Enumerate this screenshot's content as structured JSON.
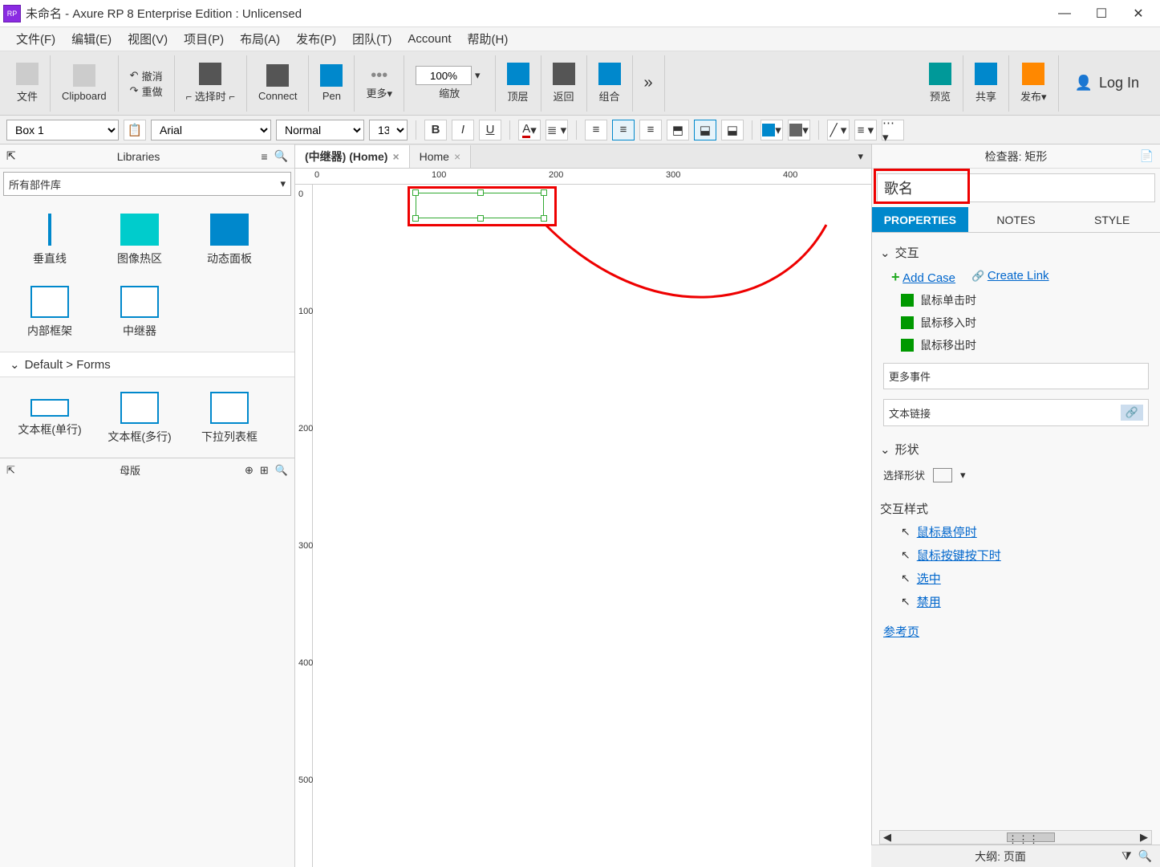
{
  "titlebar": {
    "logo": "RP",
    "title": "未命名 - Axure RP 8 Enterprise Edition : Unlicensed"
  },
  "menubar": [
    "文件(F)",
    "编辑(E)",
    "视图(V)",
    "项目(P)",
    "布局(A)",
    "发布(P)",
    "团队(T)",
    "Account",
    "帮助(H)"
  ],
  "toolbar": {
    "file": "文件",
    "clipboard": "Clipboard",
    "undo": "撤消",
    "redo": "重做",
    "select_mode": "选择时",
    "connect": "Connect",
    "pen": "Pen",
    "more": "更多▾",
    "zoom_value": "100%",
    "zoom_label": "缩放",
    "top": "顶层",
    "back": "返回",
    "group": "组合",
    "preview": "预览",
    "share": "共享",
    "publish": "发布▾",
    "login": "Log In"
  },
  "formatbar": {
    "shape_style": "Box 1",
    "font": "Arial",
    "weight": "Normal",
    "size": "13"
  },
  "left": {
    "libraries_title": "Libraries",
    "lib_selector": "所有部件库",
    "items": [
      {
        "label": "垂直线"
      },
      {
        "label": "图像热区"
      },
      {
        "label": "动态面板"
      },
      {
        "label": "内部框架"
      },
      {
        "label": "中继器"
      }
    ],
    "forms_section": "Default > Forms",
    "forms": [
      {
        "label": "文本框(单行)"
      },
      {
        "label": "文本框(多行)"
      },
      {
        "label": "下拉列表框"
      }
    ],
    "masters_title": "母版"
  },
  "canvas": {
    "tabs": [
      {
        "label": "(中继器) (Home)",
        "active": true
      },
      {
        "label": "Home",
        "active": false
      }
    ],
    "ruler_ticks_h": [
      "0",
      "100",
      "200",
      "300",
      "400"
    ],
    "ruler_ticks_v": [
      "0",
      "100",
      "200",
      "300",
      "400",
      "500"
    ]
  },
  "right": {
    "inspector_title": "检查器: 矩形",
    "widget_name": "歌名",
    "tabs": [
      "PROPERTIES",
      "NOTES",
      "STYLE"
    ],
    "active_tab": 0,
    "interactions": {
      "title": "交互",
      "add_case": "Add Case",
      "create_link": "Create Link",
      "events": [
        "鼠标单击时",
        "鼠标移入时",
        "鼠标移出时"
      ],
      "more_events": "更多事件"
    },
    "text_link": "文本链接",
    "shape": {
      "title": "形状",
      "select_shape": "选择形状"
    },
    "ix_styles": {
      "title": "交互样式",
      "items": [
        "鼠标悬停时",
        "鼠标按键按下时",
        "选中",
        "禁用"
      ]
    },
    "reference_page": "参考页"
  },
  "footer": {
    "outline": "大纲: 页面"
  }
}
